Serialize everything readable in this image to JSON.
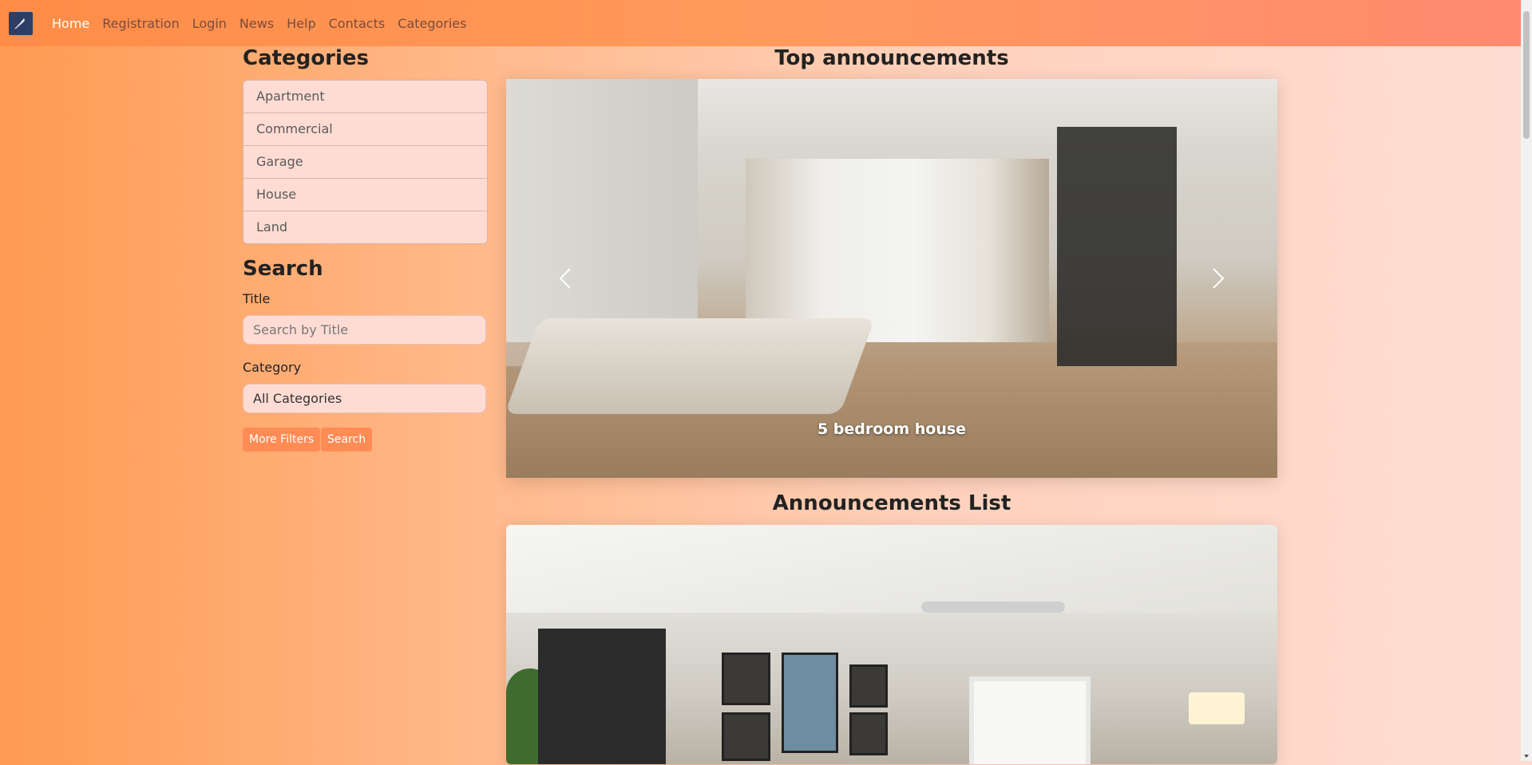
{
  "nav": {
    "links": [
      {
        "label": "Home",
        "active": true
      },
      {
        "label": "Registration"
      },
      {
        "label": "Login"
      },
      {
        "label": "News"
      },
      {
        "label": "Help"
      },
      {
        "label": "Contacts"
      },
      {
        "label": "Categories"
      }
    ]
  },
  "sidebar": {
    "categories_title": "Categories",
    "categories": [
      "Apartment",
      "Commercial",
      "Garage",
      "House",
      "Land"
    ],
    "search_title": "Search",
    "title_label": "Title",
    "title_placeholder": "Search by Title",
    "category_label": "Category",
    "category_selected": "All Categories",
    "more_filters_label": "More Filters",
    "search_button_label": "Search"
  },
  "main": {
    "top_title": "Top announcements",
    "carousel_caption": "5 bedroom house",
    "list_title": "Announcements List"
  },
  "colors": {
    "accent": "#ff8b55",
    "nav_bg": "#ff8c47"
  }
}
